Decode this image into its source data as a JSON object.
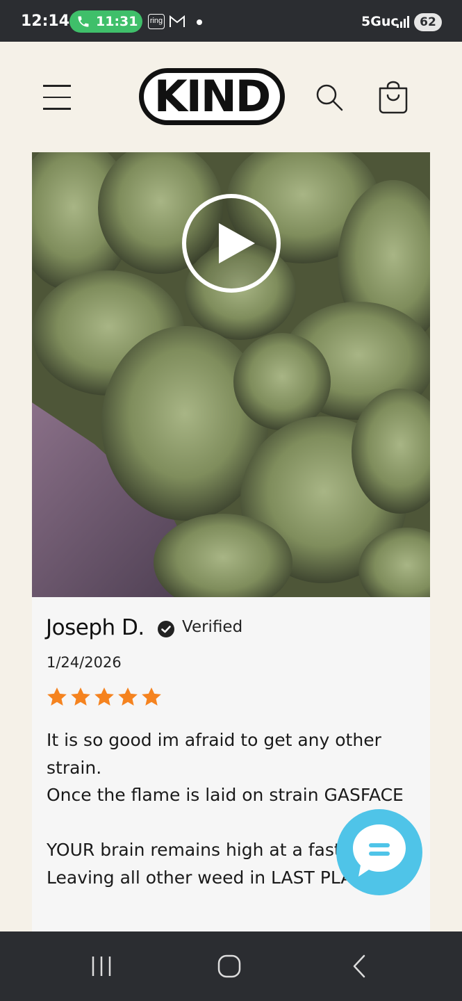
{
  "status_bar": {
    "time": "12:14",
    "call_duration": "11:31",
    "ring_label": "ring",
    "network": "5Guc",
    "battery": "62"
  },
  "header": {
    "logo_text": "KIND",
    "icons": [
      "menu-icon",
      "search-icon",
      "cart-icon"
    ]
  },
  "review": {
    "reviewer_name": "Joseph D.",
    "verified_label": "Verified",
    "date": "1/24/2026",
    "rating": 5,
    "rating_max": 5,
    "text_lines": [
      "It is so good im afraid to get any other strain.",
      "Once the flame is laid on strain GASFACE",
      "",
      "YOUR brain remains high at a fast",
      "Leaving all other weed in LAST PLACE"
    ]
  },
  "colors": {
    "status_bar_bg": "#2b2d31",
    "page_bg": "#f5f1e8",
    "star": "#f5831f",
    "chat_button": "#4fc4e8",
    "call_pill": "#3fbf6a"
  }
}
